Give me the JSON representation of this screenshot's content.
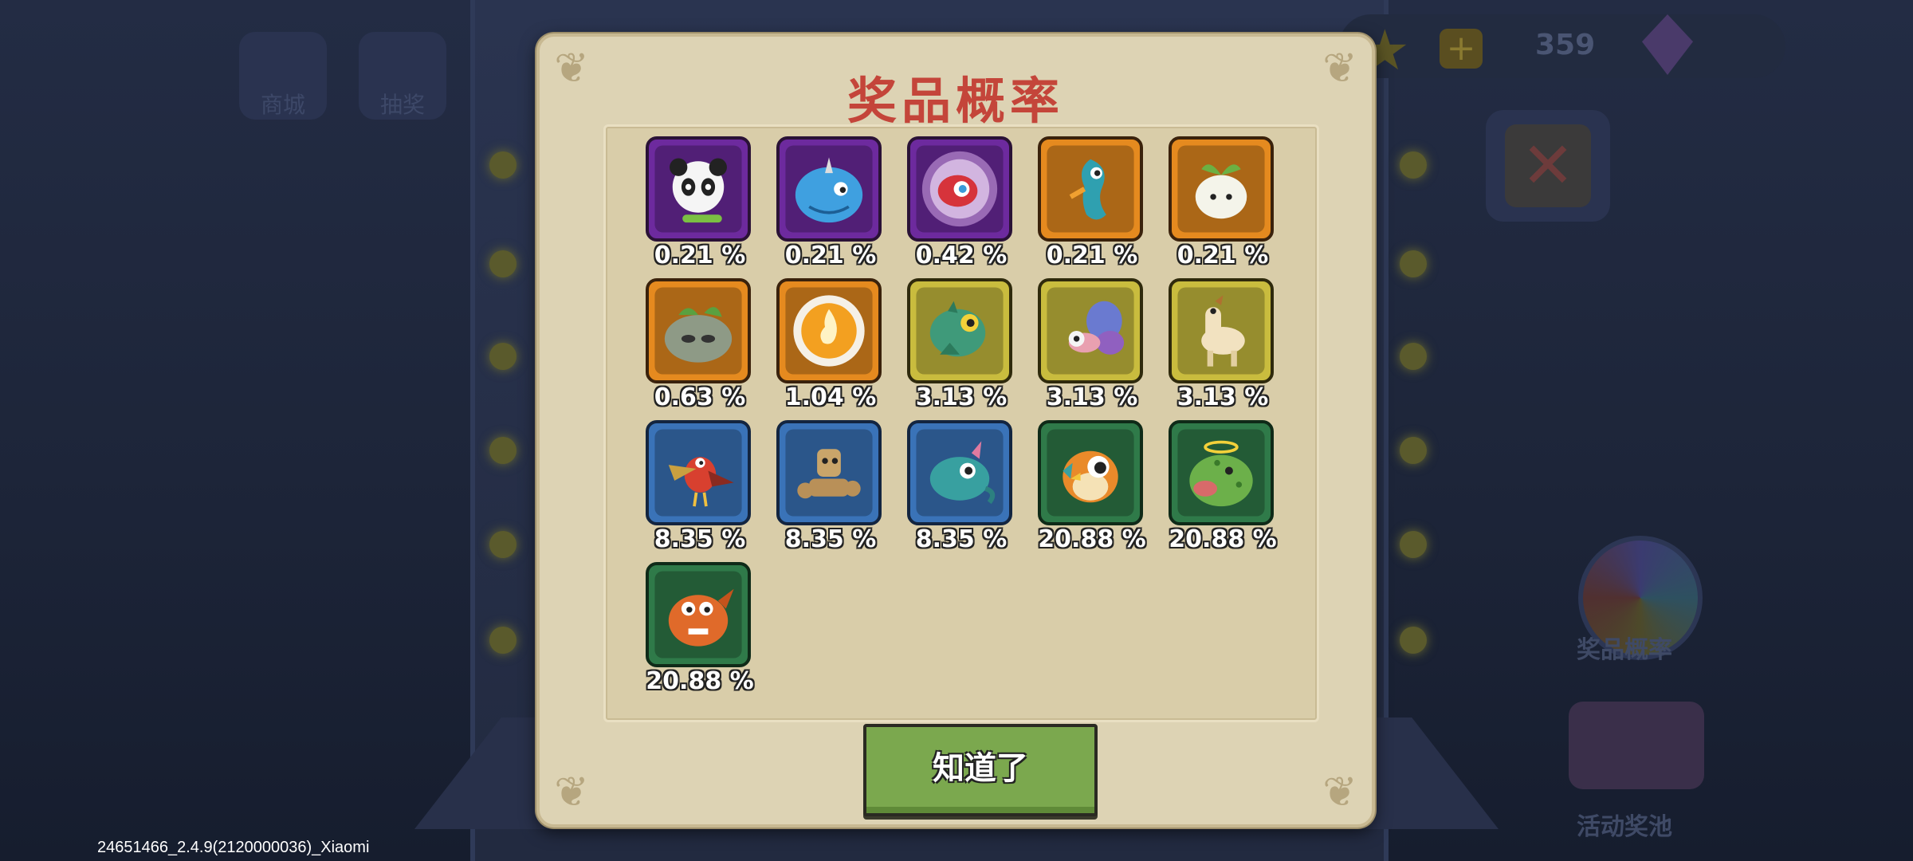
{
  "dialog": {
    "title": "奖品概率",
    "confirm_label": "知道了"
  },
  "prizes": [
    {
      "tier": "purple",
      "icon": "panda-pet-icon",
      "probability": "0.21 %"
    },
    {
      "tier": "purple",
      "icon": "blue-whale-pet-icon",
      "probability": "0.21 %"
    },
    {
      "tier": "purple",
      "icon": "red-eye-orb-icon",
      "probability": "0.42 %"
    },
    {
      "tier": "orange",
      "icon": "seahorse-pet-icon",
      "probability": "0.21 %"
    },
    {
      "tier": "orange",
      "icon": "sprout-creature-icon",
      "probability": "0.21 %"
    },
    {
      "tier": "orange",
      "icon": "leafy-rock-creature-icon",
      "probability": "0.63 %"
    },
    {
      "tier": "orange",
      "icon": "fire-coin-icon",
      "probability": "1.04 %"
    },
    {
      "tier": "yellow",
      "icon": "green-dragon-icon",
      "probability": "3.13 %"
    },
    {
      "tier": "yellow",
      "icon": "butterfly-bug-icon",
      "probability": "3.13 %"
    },
    {
      "tier": "yellow",
      "icon": "alpaca-pet-icon",
      "probability": "3.13 %"
    },
    {
      "tier": "blue",
      "icon": "red-bird-icon",
      "probability": "8.35 %"
    },
    {
      "tier": "blue",
      "icon": "rock-golem-icon",
      "probability": "8.35 %"
    },
    {
      "tier": "blue",
      "icon": "teal-beast-icon",
      "probability": "8.35 %"
    },
    {
      "tier": "green",
      "icon": "orange-owl-icon",
      "probability": "20.88 %"
    },
    {
      "tier": "green",
      "icon": "green-blob-angel-icon",
      "probability": "20.88 %"
    },
    {
      "tier": "green",
      "icon": "orange-fish-monster-icon",
      "probability": "20.88 %"
    }
  ],
  "background": {
    "tab_store": "商城",
    "tab_draw": "抽奖",
    "currency_count": "359",
    "side_button_prob": "奖品概率",
    "side_button_pool": "活动奖池"
  },
  "build_info": "24651466_2.4.9(2120000036)_Xiaomi",
  "colors": {
    "title": "#c4453a",
    "confirm_button": "#7ba84e",
    "dialog_bg": "#ddd3b4"
  }
}
